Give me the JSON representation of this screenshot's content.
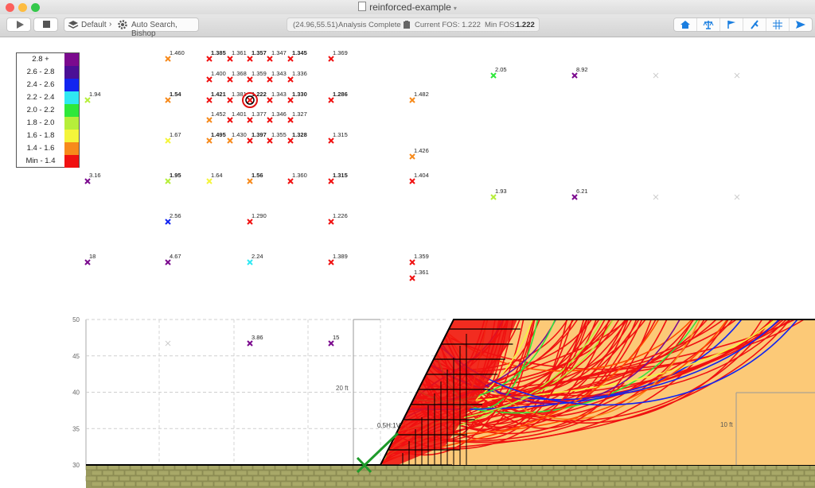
{
  "window": {
    "title": "reinforced-example"
  },
  "toolbar": {
    "scenario": "Default",
    "method": "Auto Search, Bishop",
    "coords": "(24.96,55.51)",
    "analysis": "Analysis Complete",
    "current_fos": "Current FOS: 1.222",
    "min_fos_label": "Min FOS:",
    "min_fos_value": "1.222",
    "right_icons": [
      "home-icon",
      "balance-icon",
      "flag-icon",
      "anchor-icon",
      "grid-icon",
      "send-icon"
    ]
  },
  "legend": [
    {
      "label": "2.8 +",
      "color": "#7b0a8e"
    },
    {
      "label": "2.6 - 2.8",
      "color": "#4b0f96"
    },
    {
      "label": "2.4 - 2.6",
      "color": "#1224f0"
    },
    {
      "label": "2.2 - 2.4",
      "color": "#2fe8f2"
    },
    {
      "label": "2.0 - 2.2",
      "color": "#2ee83a"
    },
    {
      "label": "1.8 - 2.0",
      "color": "#b6ee3a"
    },
    {
      "label": "1.6 - 1.8",
      "color": "#f4f53b"
    },
    {
      "label": "1.4 - 1.6",
      "color": "#f78a1b"
    },
    {
      "label": "Min - 1.4",
      "color": "#f01111"
    }
  ],
  "grid_points": [
    [
      "1.460",
      "#f78a1b",
      false
    ],
    [
      "1.385",
      "#f01111",
      true
    ],
    [
      "1.361",
      "#f01111",
      false
    ],
    [
      "1.357",
      "#f01111",
      true
    ],
    [
      "1.347",
      "#f01111",
      false
    ],
    [
      "1.345",
      "#f01111",
      true
    ],
    [
      "1.369",
      "#f01111",
      false
    ],
    [
      "1.400",
      "#f01111",
      false
    ],
    [
      "1.368",
      "#f01111",
      false
    ],
    [
      "1.359",
      "#f01111",
      false
    ],
    [
      "1.343",
      "#f01111",
      false
    ],
    [
      "1.336",
      "#f01111",
      false
    ],
    [
      "1.94",
      "#b6ee3a",
      false
    ],
    [
      "1.54",
      "#f78a1b",
      true
    ],
    [
      "1.421",
      "#f01111",
      true
    ],
    [
      "1.381",
      "#f01111",
      false
    ],
    [
      "1.222",
      "#f01111",
      true
    ],
    [
      "1.343",
      "#f01111",
      false
    ],
    [
      "1.330",
      "#f01111",
      true
    ],
    [
      "1.286",
      "#f01111",
      true
    ],
    [
      "1.482",
      "#f78a1b",
      false
    ],
    [
      "1.452",
      "#f78a1b",
      false
    ],
    [
      "1.401",
      "#f01111",
      false
    ],
    [
      "1.377",
      "#f01111",
      false
    ],
    [
      "1.346",
      "#f01111",
      false
    ],
    [
      "1.327",
      "#f01111",
      false
    ],
    [
      "1.67",
      "#f4f53b",
      false
    ],
    [
      "1.495",
      "#f78a1b",
      true
    ],
    [
      "1.430",
      "#f78a1b",
      false
    ],
    [
      "1.397",
      "#f01111",
      true
    ],
    [
      "1.355",
      "#f01111",
      false
    ],
    [
      "1.328",
      "#f01111",
      true
    ],
    [
      "1.315",
      "#f01111",
      false
    ],
    [
      "1.426",
      "#f78a1b",
      false
    ],
    [
      "3.16",
      "#7b0a8e",
      false
    ],
    [
      "1.95",
      "#b6ee3a",
      true
    ],
    [
      "1.64",
      "#f4f53b",
      false
    ],
    [
      "1.56",
      "#f78a1b",
      true
    ],
    [
      "1.360",
      "#f01111",
      false
    ],
    [
      "1.315",
      "#f01111",
      true
    ],
    [
      "1.404",
      "#f01111",
      false
    ],
    [
      "2.56",
      "#1224f0",
      false
    ],
    [
      "1.290",
      "#f01111",
      false
    ],
    [
      "1.226",
      "#f01111",
      false
    ],
    [
      "18",
      "#7b0a8e",
      false
    ],
    [
      "4.67",
      "#7b0a8e",
      false
    ],
    [
      "2.24",
      "#2fe8f2",
      false
    ],
    [
      "1.389",
      "#f01111",
      false
    ],
    [
      "1.359",
      "#f01111",
      false
    ],
    [
      "1.361",
      "#f01111",
      false
    ],
    [
      "2.05",
      "#2ee83a",
      false
    ],
    [
      "8.92",
      "#7b0a8e",
      false
    ],
    [
      "",
      "#cccccc",
      false
    ],
    [
      "",
      "#cccccc",
      false
    ],
    [
      "1.93",
      "#b6ee3a",
      false
    ],
    [
      "6.21",
      "#7b0a8e",
      false
    ],
    [
      "",
      "#cccccc",
      false
    ],
    [
      "",
      "#cccccc",
      false
    ],
    [
      "",
      "#cccccc",
      false
    ],
    [
      "3.86",
      "#7b0a8e",
      false
    ],
    [
      "15",
      "#7b0a8e",
      false
    ]
  ],
  "axis": {
    "y_ticks": [
      "50",
      "45",
      "40",
      "35",
      "30"
    ]
  },
  "annotations": {
    "height_left": "20 ft",
    "height_right": "10 ft",
    "slope": "0.5H:1V"
  }
}
